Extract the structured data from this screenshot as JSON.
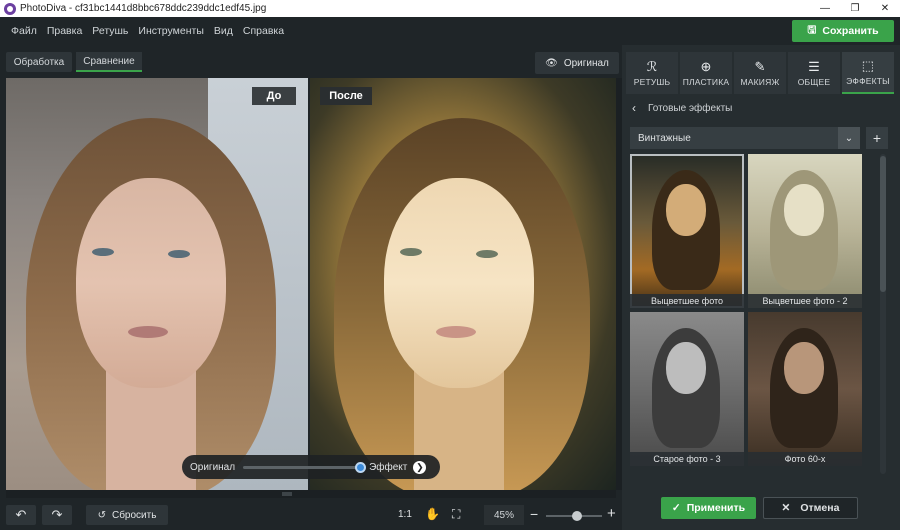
{
  "window": {
    "title": "PhotoDiva - cf31bc1441d8bbc678ddc239ddc1edf45.jpg"
  },
  "menu": [
    "Файл",
    "Правка",
    "Ретушь",
    "Инструменты",
    "Вид",
    "Справка"
  ],
  "header": {
    "save_label": "Сохранить"
  },
  "tabs": {
    "processing": "Обработка",
    "compare": "Сравнение",
    "original_toggle": "Оригинал"
  },
  "canvas": {
    "label_before": "До",
    "label_after": "После",
    "slider_left": "Оригинал",
    "slider_right": "Эффект",
    "effect_level": 1.0
  },
  "toolbar": {
    "reset_label": "Сбросить",
    "zoom_1to1": "1:1",
    "zoom_value": "45%",
    "zoom_level": 0.55
  },
  "panel": {
    "categories": [
      {
        "label": "РЕТУШЬ",
        "icon": "retouch-icon"
      },
      {
        "label": "ПЛАСТИКА",
        "icon": "liquify-icon"
      },
      {
        "label": "МАКИЯЖ",
        "icon": "makeup-icon"
      },
      {
        "label": "ОБЩЕЕ",
        "icon": "sliders-icon"
      },
      {
        "label": "ЭФФЕКТЫ",
        "icon": "effects-icon",
        "active": true
      }
    ],
    "section_title": "Готовые эффекты",
    "dropdown_value": "Винтажные",
    "effects": [
      {
        "name": "Выцветшее фото",
        "selected": true
      },
      {
        "name": "Выцветшее фото - 2"
      },
      {
        "name": "Старое фото - 3"
      },
      {
        "name": "Фото 60-х"
      }
    ],
    "apply_label": "Применить",
    "cancel_label": "Отмена"
  },
  "colors": {
    "accent": "#3aa34a",
    "background": "#1f2528",
    "panel": "#262d30"
  }
}
